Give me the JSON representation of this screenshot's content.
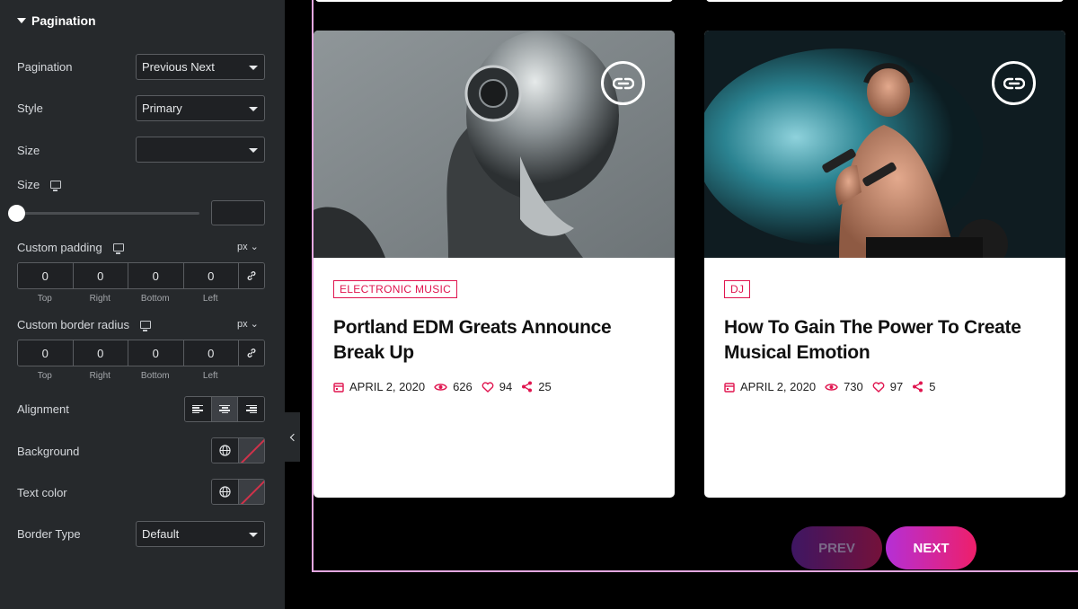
{
  "panel": {
    "section_title": "Pagination",
    "pagination": {
      "label": "Pagination",
      "value": "Previous Next"
    },
    "style": {
      "label": "Style",
      "value": "Primary"
    },
    "size_select": {
      "label": "Size",
      "value": ""
    },
    "size_slider": {
      "label": "Size",
      "value": ""
    },
    "custom_padding": {
      "label": "Custom padding",
      "unit": "px",
      "values": [
        "0",
        "0",
        "0",
        "0"
      ],
      "sides": [
        "Top",
        "Right",
        "Bottom",
        "Left"
      ]
    },
    "custom_border_radius": {
      "label": "Custom border radius",
      "unit": "px",
      "values": [
        "0",
        "0",
        "0",
        "0"
      ],
      "sides": [
        "Top",
        "Right",
        "Bottom",
        "Left"
      ]
    },
    "alignment": {
      "label": "Alignment",
      "options": [
        "left",
        "center",
        "right"
      ],
      "selected": "center"
    },
    "background": {
      "label": "Background"
    },
    "text_color": {
      "label": "Text color"
    },
    "border_type": {
      "label": "Border Type",
      "value": "Default"
    }
  },
  "posts": [
    {
      "category": "ELECTRONIC MUSIC",
      "title": "Portland EDM Greats Announce Break Up",
      "date": "APRIL 2, 2020",
      "views": "626",
      "likes": "94",
      "shares": "25"
    },
    {
      "category": "DJ",
      "title": "How To Gain The Power To Create Musical Emotion",
      "date": "APRIL 2, 2020",
      "views": "730",
      "likes": "97",
      "shares": "5"
    }
  ],
  "pager": {
    "prev_label": "PREV",
    "next_label": "NEXT"
  },
  "colors": {
    "accent": "#e0154f",
    "panel_bg": "#26292c",
    "frame": "#e4a7e0"
  }
}
